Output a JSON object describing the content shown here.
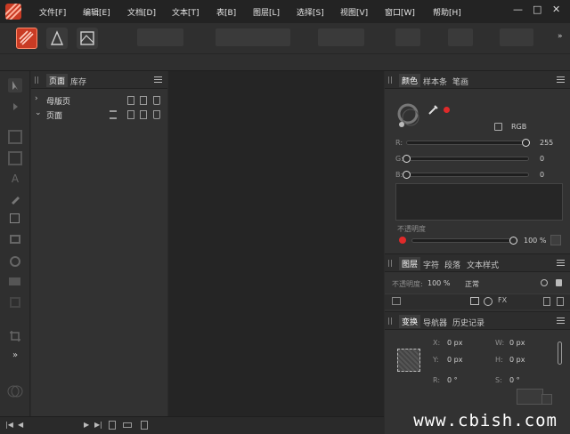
{
  "menu": [
    "文件[F]",
    "编辑[E]",
    "文档[D]",
    "文本[T]",
    "表[B]",
    "图层[L]",
    "选择[S]",
    "视图[V]",
    "窗口[W]",
    "帮助[H]"
  ],
  "window_controls": {
    "minimize": "—",
    "maximize": "□",
    "close": "✕"
  },
  "pages_panel": {
    "tabs": [
      "页面",
      "库存"
    ],
    "rows": [
      {
        "label": "母版页",
        "expanded": false
      },
      {
        "label": "页面",
        "expanded": true
      }
    ]
  },
  "color_panel": {
    "tabs": [
      "颜色",
      "样本条",
      "笔画"
    ],
    "mode": "RGB",
    "r_label": "R:",
    "r_value": "255",
    "r_fraction": 1.0,
    "g_label": "G:",
    "g_value": "0",
    "g_fraction": 0.0,
    "b_label": "B:",
    "b_value": "0",
    "b_fraction": 0.0,
    "opacity_label": "不透明度",
    "opacity_value": "100 %",
    "opacity_fraction": 1.0,
    "accent": "#e02a2a"
  },
  "layers_panel": {
    "tabs": [
      "图层",
      "字符",
      "段落",
      "文本样式"
    ],
    "opacity_label": "不透明度:",
    "opacity_value": "100 %",
    "blend_mode": "正常"
  },
  "transform_panel": {
    "tabs": [
      "变换",
      "导航器",
      "历史记录"
    ],
    "x_label": "X:",
    "x_value": "0 px",
    "y_label": "Y:",
    "y_value": "0 px",
    "w_label": "W:",
    "w_value": "0 px",
    "h_label": "H:",
    "h_value": "0 px",
    "r_label": "R:",
    "r_value": "0 °",
    "s_label": "S:",
    "s_value": "0 °"
  },
  "watermark": "www.cbish.com"
}
